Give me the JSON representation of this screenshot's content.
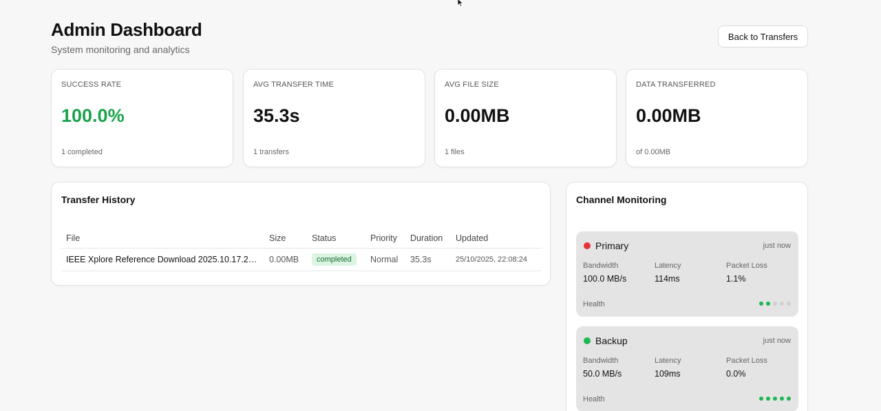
{
  "header": {
    "title": "Admin Dashboard",
    "subtitle": "System monitoring and analytics",
    "back_label": "Back to Transfers"
  },
  "stats": [
    {
      "label": "SUCCESS RATE",
      "value": "100.0%",
      "sub": "1 completed",
      "color": "#1aa34a"
    },
    {
      "label": "AVG TRANSFER TIME",
      "value": "35.3s",
      "sub": "1 transfers"
    },
    {
      "label": "AVG FILE SIZE",
      "value": "0.00MB",
      "sub": "1 files"
    },
    {
      "label": "DATA TRANSFERRED",
      "value": "0.00MB",
      "sub": "of 0.00MB"
    }
  ],
  "history": {
    "title": "Transfer History",
    "columns": [
      "File",
      "Size",
      "Status",
      "Priority",
      "Duration",
      "Updated"
    ],
    "rows": [
      {
        "file": "IEEE Xplore Reference Download 2025.10.17.20.4...",
        "size": "0.00MB",
        "status": "completed",
        "priority": "Normal",
        "duration": "35.3s",
        "updated": "25/10/2025, 22:08:24"
      }
    ]
  },
  "channels": {
    "title": "Channel Monitoring",
    "labels": {
      "bandwidth": "Bandwidth",
      "latency": "Latency",
      "packet_loss": "Packet Loss",
      "health": "Health"
    },
    "items": [
      {
        "name": "Primary",
        "time": "just now",
        "status_color": "#e5333b",
        "bandwidth": "100.0 MB/s",
        "latency": "114ms",
        "packet_loss": "1.1%",
        "health": 2,
        "health_max": 5
      },
      {
        "name": "Backup",
        "time": "just now",
        "status_color": "#1fb653",
        "bandwidth": "50.0 MB/s",
        "latency": "109ms",
        "packet_loss": "0.0%",
        "health": 5,
        "health_max": 5
      }
    ]
  },
  "colors": {
    "accent_green": "#1aa34a",
    "badge_bg": "#dcf5e3"
  }
}
